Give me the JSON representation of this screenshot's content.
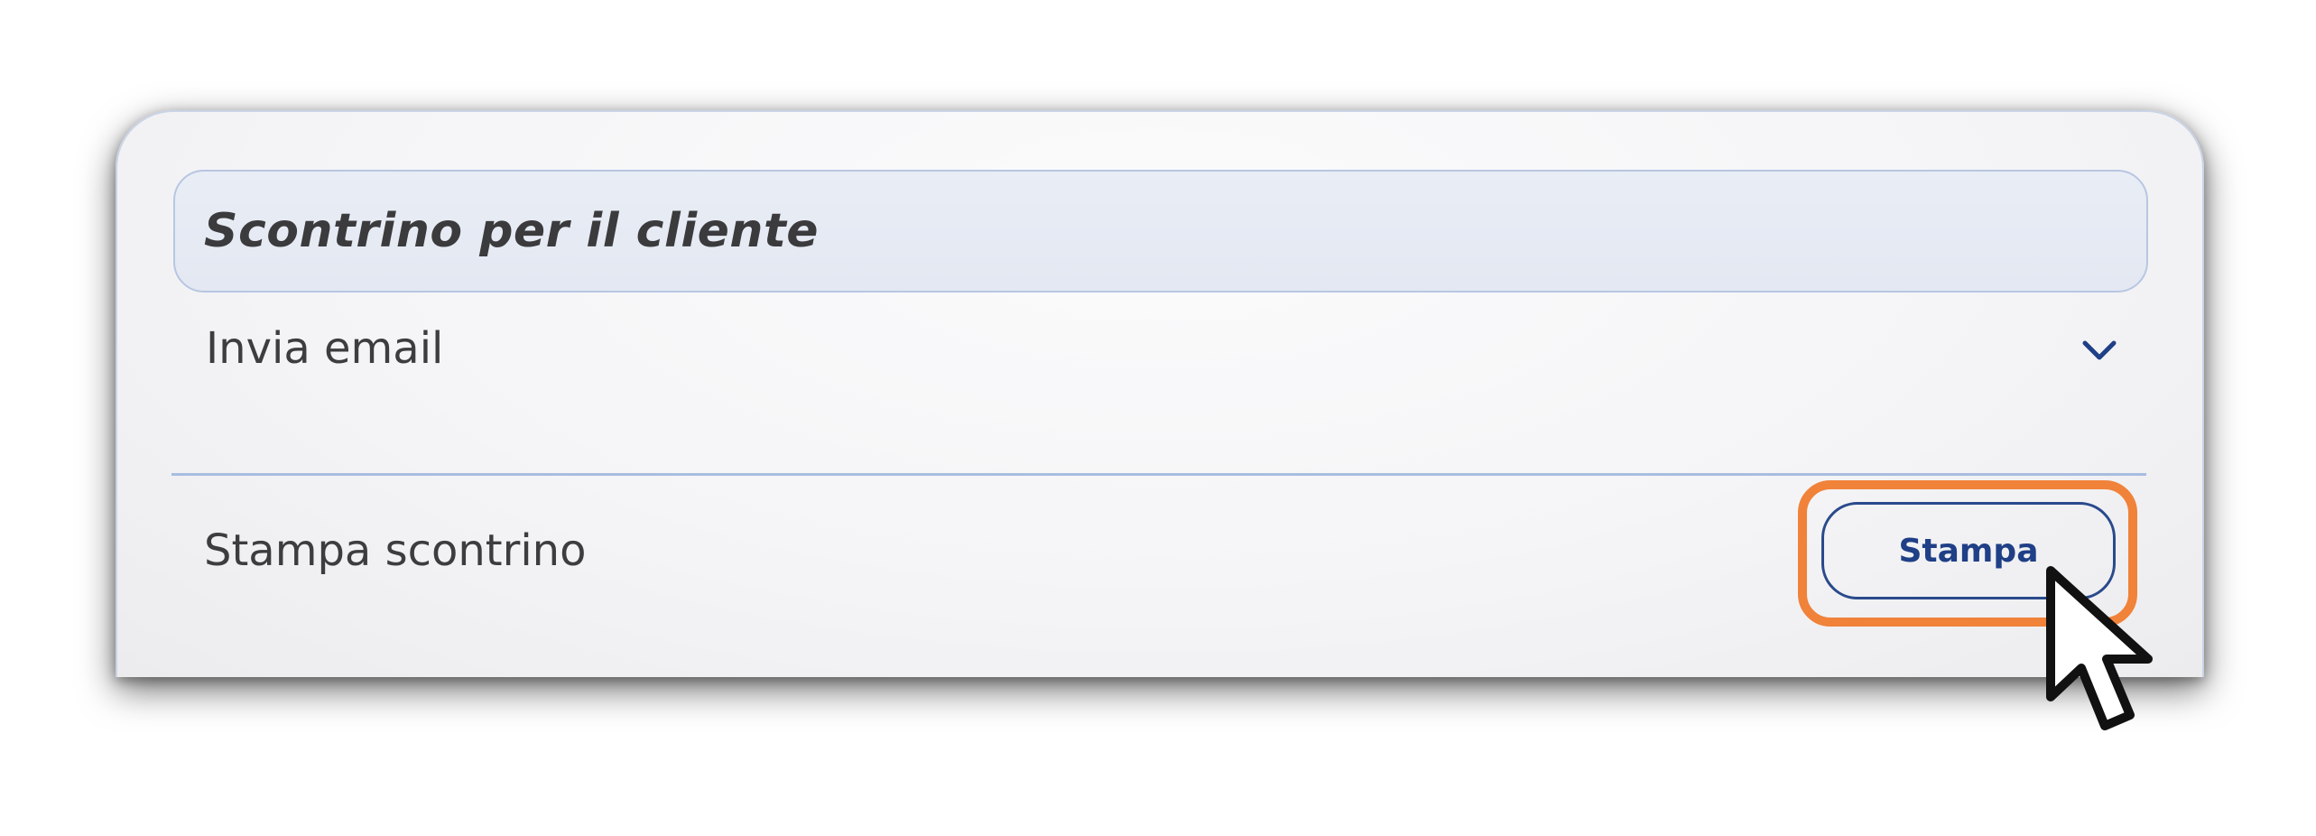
{
  "panel": {
    "title": "Scontrino per il cliente"
  },
  "email_row": {
    "label": "Invia email",
    "icon": "chevron-down-icon"
  },
  "print_row": {
    "label": "Stampa scontrino",
    "button_label": "Stampa"
  },
  "colors": {
    "accent_blue": "#1f3f86",
    "highlight_orange": "#f0823a",
    "divider": "#a8bde0"
  }
}
